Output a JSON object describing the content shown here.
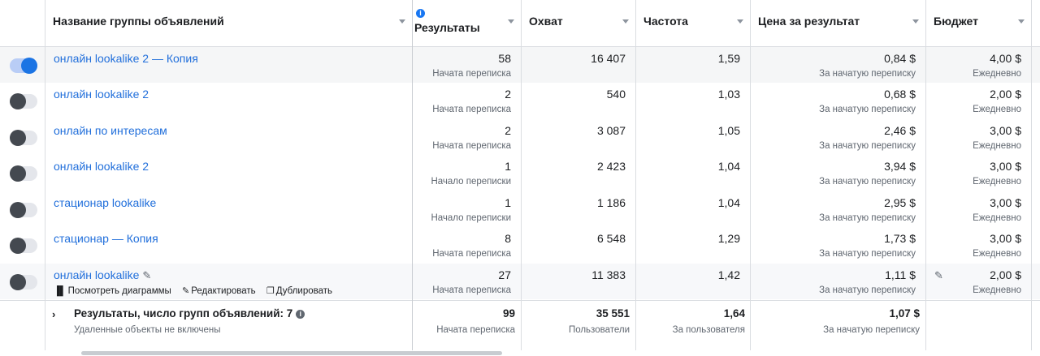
{
  "columns": {
    "name": "Название группы объявлений",
    "results": "Результаты",
    "reach": "Охват",
    "frequency": "Частота",
    "cost": "Цена за результат",
    "budget": "Бюджет"
  },
  "rows": [
    {
      "name": "онлайн lookalike 2 — Копия",
      "active": true,
      "results": "58",
      "results_label": "Начата переписка",
      "reach": "16 407",
      "frequency": "1,59",
      "cost": "0,84 $",
      "cost_label": "За начатую переписку",
      "budget": "4,00 $",
      "budget_label": "Ежедневно"
    },
    {
      "name": "онлайн lookalike 2",
      "active": false,
      "results": "2",
      "results_label": "Начата переписка",
      "reach": "540",
      "frequency": "1,03",
      "cost": "0,68 $",
      "cost_label": "За начатую переписку",
      "budget": "2,00 $",
      "budget_label": "Ежедневно"
    },
    {
      "name": "онлайн по интересам",
      "active": false,
      "results": "2",
      "results_label": "Начата переписка",
      "reach": "3 087",
      "frequency": "1,05",
      "cost": "2,46 $",
      "cost_label": "За начатую переписку",
      "budget": "3,00 $",
      "budget_label": "Ежедневно"
    },
    {
      "name": "онлайн lookalike 2",
      "active": false,
      "results": "1",
      "results_label": "Начало переписки",
      "reach": "2 423",
      "frequency": "1,04",
      "cost": "3,94 $",
      "cost_label": "За начатую переписку",
      "budget": "3,00 $",
      "budget_label": "Ежедневно"
    },
    {
      "name": "стационар lookalike",
      "active": false,
      "results": "1",
      "results_label": "Начало переписки",
      "reach": "1 186",
      "frequency": "1,04",
      "cost": "2,95 $",
      "cost_label": "За начатую переписку",
      "budget": "3,00 $",
      "budget_label": "Ежедневно"
    },
    {
      "name": "стационар — Копия",
      "active": false,
      "results": "8",
      "results_label": "Начата переписка",
      "reach": "6 548",
      "frequency": "1,29",
      "cost": "1,73 $",
      "cost_label": "За начатую переписку",
      "budget": "3,00 $",
      "budget_label": "Ежедневно"
    },
    {
      "name": "онлайн lookalike",
      "active": false,
      "results": "27",
      "results_label": "Начата переписка",
      "reach": "11 383",
      "frequency": "1,42",
      "cost": "1,11 $",
      "cost_label": "За начатую переписку",
      "budget": "2,00 $",
      "budget_label": "Ежедневно"
    }
  ],
  "row_actions": {
    "charts": "Посмотреть диаграммы",
    "edit": "Редактировать",
    "duplicate": "Дублировать"
  },
  "footer": {
    "title": "Результаты, число групп объявлений: 7",
    "subtitle": "Удаленные объекты не включены",
    "results": "99",
    "results_label": "Начата переписка",
    "reach": "35 551",
    "reach_label": "Пользователи",
    "frequency": "1,64",
    "frequency_label": "За пользователя",
    "cost": "1,07 $",
    "cost_label": "За начатую переписку"
  },
  "icons": {
    "info": "info-icon",
    "sort": "sort-arrow-icon",
    "pencil": "pencil-icon",
    "chart": "bar-chart-icon",
    "duplicate": "duplicate-icon",
    "expand": "chevron-right-icon"
  },
  "colors": {
    "link": "#216fdb",
    "toggle_on": "#1b74e4",
    "toggle_off": "#444950",
    "info": "#1877f2"
  }
}
